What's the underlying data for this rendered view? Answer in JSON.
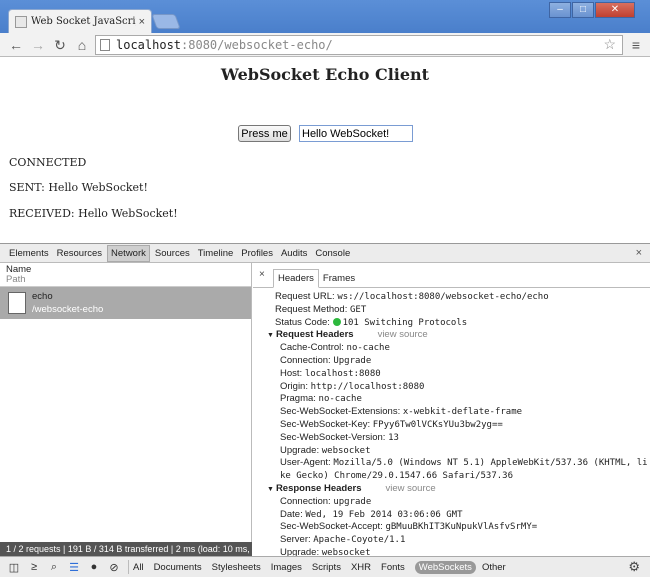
{
  "window": {
    "tab_title": "Web Socket JavaScript E",
    "tab_close": "×",
    "minimize": "–",
    "maximize": "□",
    "close": "✕"
  },
  "toolbar": {
    "back": "←",
    "forward": "→",
    "reload": "↻",
    "home": "⌂",
    "url_host": "localhost",
    "url_rest": ":8080/websocket-echo/",
    "star": "☆",
    "menu": "≡"
  },
  "page": {
    "title": "WebSocket Echo Client",
    "button_label": "Press me",
    "input_value": "Hello WebSocket!",
    "status": "CONNECTED",
    "sent": "SENT: Hello WebSocket!",
    "received": "RECEIVED: Hello WebSocket!"
  },
  "devtools": {
    "tabs": [
      "Elements",
      "Resources",
      "Network",
      "Sources",
      "Timeline",
      "Profiles",
      "Audits",
      "Console"
    ],
    "close": "×",
    "col_name": "Name",
    "col_path": "Path",
    "request_name": "echo",
    "request_path": "/websocket-echo",
    "subtabs": [
      "Headers",
      "Frames"
    ],
    "subtab_close": "×",
    "general": [
      {
        "k": "Request URL:",
        "v": "ws://localhost:8080/websocket-echo/echo"
      },
      {
        "k": "Request Method:",
        "v": "GET"
      },
      {
        "k": "Status Code:",
        "v": "101 Switching Protocols"
      }
    ],
    "request_headers_label": "Request Headers",
    "view_source": "view source",
    "request_headers": [
      {
        "k": "Cache-Control:",
        "v": "no-cache"
      },
      {
        "k": "Connection:",
        "v": "Upgrade"
      },
      {
        "k": "Host:",
        "v": "localhost:8080"
      },
      {
        "k": "Origin:",
        "v": "http://localhost:8080"
      },
      {
        "k": "Pragma:",
        "v": "no-cache"
      },
      {
        "k": "Sec-WebSocket-Extensions:",
        "v": "x-webkit-deflate-frame"
      },
      {
        "k": "Sec-WebSocket-Key:",
        "v": "FPyy6Tw0lVCKsYUu3bw2yg=="
      },
      {
        "k": "Sec-WebSocket-Version:",
        "v": "13"
      },
      {
        "k": "Upgrade:",
        "v": "websocket"
      },
      {
        "k": "User-Agent:",
        "v": "Mozilla/5.0 (Windows NT 5.1) AppleWebKit/537.36 (KHTML, li"
      }
    ],
    "ua_continuation": "ke Gecko) Chrome/29.0.1547.66 Safari/537.36",
    "response_headers_label": "Response Headers",
    "response_headers": [
      {
        "k": "Connection:",
        "v": "upgrade"
      },
      {
        "k": "Date:",
        "v": "Wed, 19 Feb 2014 03:06:06 GMT"
      },
      {
        "k": "Sec-WebSocket-Accept:",
        "v": "gBMuuBKhIT3KuNpukVlAsfvSrMY="
      },
      {
        "k": "Server:",
        "v": "Apache-Coyote/1.1"
      },
      {
        "k": "Upgrade:",
        "v": "websocket"
      }
    ],
    "status_summary": "1 / 2 requests | 191 B / 314 B transferred | 2 ms (load: 10 ms, D",
    "filters": [
      "All",
      "Documents",
      "Stylesheets",
      "Images",
      "Scripts",
      "XHR",
      "Fonts",
      "WebSockets",
      "Other"
    ],
    "active_filter": "WebSockets"
  }
}
